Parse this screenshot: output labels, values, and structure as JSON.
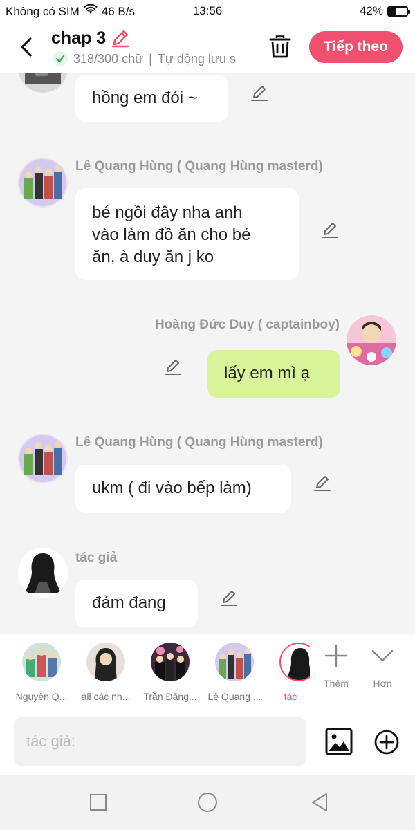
{
  "status_bar": {
    "carrier": "Không có SIM",
    "network_speed": "46 B/s",
    "time": "13:56",
    "battery": "42%",
    "battery_level": 0.42
  },
  "header": {
    "title": "chap 3",
    "word_count": "318/300 chữ",
    "separator": "|",
    "autosave": "Tự động lưu s",
    "next_label": "Tiếp theo"
  },
  "messages": [
    {
      "name": "",
      "text": "hồng em đói ~"
    },
    {
      "name": "Lê Quang Hùng ( Quang Hùng masterd)",
      "lines": [
        "bé ngồi đây nha anh",
        "vào làm đồ ăn cho bé",
        "ăn, à duy ăn j ko"
      ]
    },
    {
      "name": "Hoàng Đức Duy ( captainboy)",
      "text": "lấy em mì ạ"
    },
    {
      "name": "Lê Quang Hùng ( Quang Hùng masterd)",
      "text": "ukm ( đi vào bếp làm)"
    },
    {
      "name": "tác giả",
      "text": "đảm đang"
    }
  ],
  "characters": [
    {
      "label": "Nguyễn Q..."
    },
    {
      "label": "all các nh..."
    },
    {
      "label": "Trần Đăng..."
    },
    {
      "label": "Lê Quang ..."
    },
    {
      "label": "tác"
    }
  ],
  "tools": {
    "add_label": "Thêm",
    "more_label": "Hơn"
  },
  "input": {
    "placeholder": "tác giả:"
  },
  "colors": {
    "accent": "#f0506e",
    "my_bubble": "#d9f39a",
    "background": "#f4f4f4"
  }
}
